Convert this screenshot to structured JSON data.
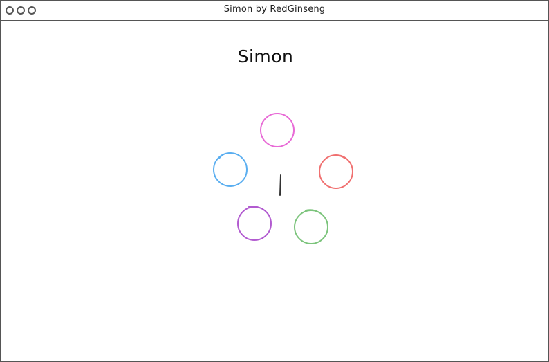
{
  "window": {
    "title": "Simon by RedGinseng",
    "controls": [
      "close-dot-icon",
      "minimize-dot-icon",
      "maximize-dot-icon"
    ]
  },
  "page": {
    "title": "Simon"
  },
  "game": {
    "buttons": [
      {
        "name": "pink-button",
        "color": "#e86bd6"
      },
      {
        "name": "red-button",
        "color": "#f07070"
      },
      {
        "name": "green-button",
        "color": "#7cc47c"
      },
      {
        "name": "purple-button",
        "color": "#b25bd0"
      },
      {
        "name": "blue-button",
        "color": "#5aaef0"
      }
    ],
    "center_marker_icon": "text-cursor-icon",
    "marker_color": "#333333"
  }
}
